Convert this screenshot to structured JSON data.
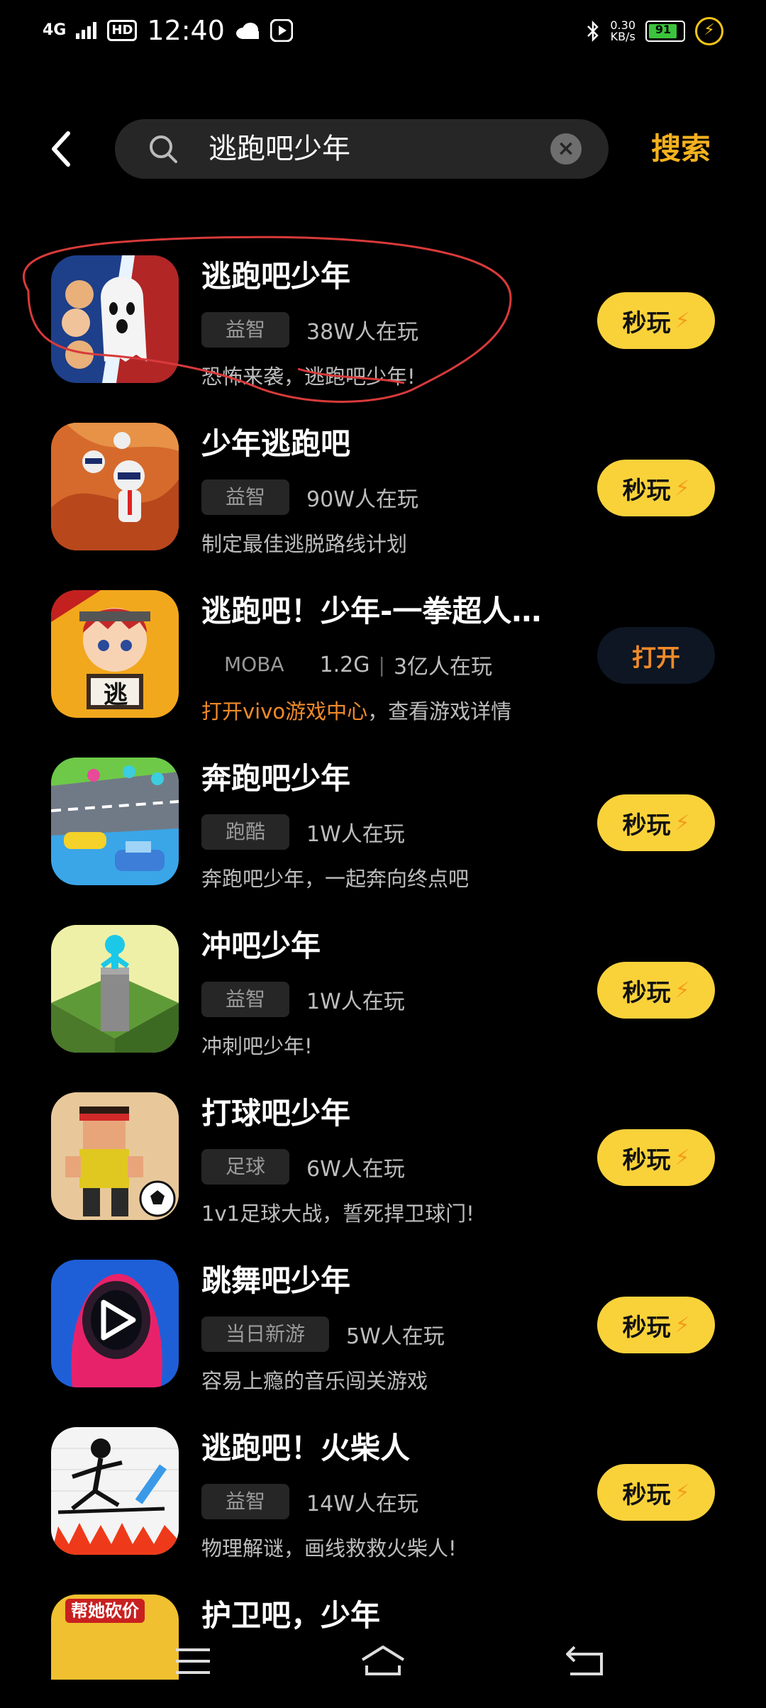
{
  "status": {
    "signal": "4G",
    "hd": "HD",
    "time": "12:40",
    "speed": "0.30",
    "speed_unit": "KB/s",
    "battery": "91"
  },
  "search": {
    "query": "逃跑吧少年",
    "button": "搜索"
  },
  "results": [
    {
      "title": "逃跑吧少年",
      "tag": "益智",
      "players": "38W人在玩",
      "desc": "恐怖来袭，逃跑吧少年!",
      "action": "秒玩"
    },
    {
      "title": "少年逃跑吧",
      "tag": "益智",
      "players": "90W人在玩",
      "desc": "制定最佳逃脱路线计划",
      "action": "秒玩"
    },
    {
      "title": "逃跑吧！少年-一拳超人…",
      "tag": "MOBA",
      "size": "1.2G",
      "players": "3亿人在玩",
      "desc_highlight": "打开vivo游戏中心",
      "desc": "，查看游戏详情",
      "action": "打开"
    },
    {
      "title": "奔跑吧少年",
      "tag": "跑酷",
      "players": "1W人在玩",
      "desc": "奔跑吧少年，一起奔向终点吧",
      "action": "秒玩"
    },
    {
      "title": "冲吧少年",
      "tag": "益智",
      "players": "1W人在玩",
      "desc": "冲刺吧少年!",
      "action": "秒玩"
    },
    {
      "title": "打球吧少年",
      "tag": "足球",
      "players": "6W人在玩",
      "desc": "1v1足球大战，誓死捍卫球门!",
      "action": "秒玩"
    },
    {
      "title": "跳舞吧少年",
      "tag": "当日新游",
      "players": "5W人在玩",
      "desc": "容易上瘾的音乐闯关游戏",
      "action": "秒玩"
    },
    {
      "title": "逃跑吧！火柴人",
      "tag": "益智",
      "players": "14W人在玩",
      "desc": "物理解谜，画线救救火柴人!",
      "action": "秒玩"
    },
    {
      "title": "护卫吧，少年",
      "icon_text": "帮她砍价"
    }
  ]
}
